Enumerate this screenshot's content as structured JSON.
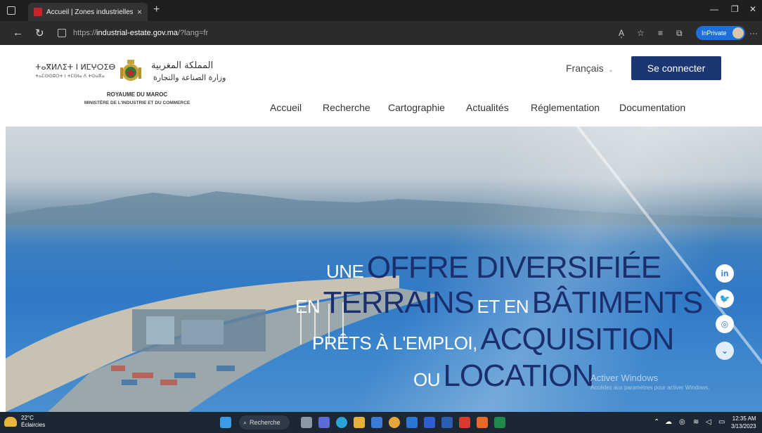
{
  "browser": {
    "tab_title": "Accueil | Zones industrielles Mar",
    "tab_close": "×",
    "new_tab": "+",
    "url_prefix": "https://",
    "url_host": "industrial-estate.gov.ma",
    "url_path": "/?lang=fr",
    "inprivate_label": "InPrivate",
    "read_aloud": "A͔",
    "minimize": "—",
    "restore": "❐",
    "close": "✕",
    "more": "···"
  },
  "header": {
    "tifinagh_1": "ⵜⴰⴳⵍⴷⵉⵜ ⵏ ⵍⵎⵖⵔⵉⴱ",
    "tifinagh_2": "ⵜⴰⵎⵙⵙⵓⵔⵜ ⵏ ⵜⵎⵙⵏⴰ ⴷ ⵜⵙⴰⴳⴰ",
    "arabic_1": "المملكة المغربية",
    "arabic_2": "وزارة الصناعة والتجارة",
    "royaume": "ROYAUME DU MAROC",
    "ministere": "MINISTÈRE DE L'INDUSTRIE ET DU COMMERCE",
    "language": "Français",
    "login_label": "Se connecter",
    "nav": [
      {
        "label": "Accueil"
      },
      {
        "label": "Recherche"
      },
      {
        "label": "Cartographie"
      },
      {
        "label": "Actualités"
      },
      {
        "label": "Réglementation"
      },
      {
        "label": "Documentation"
      }
    ]
  },
  "hero": {
    "line1_small": "UNE",
    "line1_big": "OFFRE DIVERSIFIÉE",
    "line2_small1": "EN",
    "line2_big1": "TERRAINS",
    "line2_small2": "ET EN",
    "line2_big2": "BÂTIMENTS",
    "line3_small": "PRÊTS À L'EMPLOI,",
    "line3_big": "ACQUISITION",
    "line4_small": "OU",
    "line4_big": "LOCATION",
    "social": {
      "linkedin": "in",
      "twitter": "🐦",
      "instagram": "◎",
      "scroll": "⌄"
    }
  },
  "watermark": {
    "line1": "Activer Windows",
    "line2": "Accédez aux paramètres pour activer Windows."
  },
  "taskbar": {
    "temperature": "22°C",
    "weather": "Éclaircies",
    "search_label": "Recherche",
    "time": "12:35 AM",
    "date": "3/13/2023"
  },
  "colors": {
    "navy": "#1a3773",
    "hero_blue": "#2f79c6",
    "chrome_dark": "#1f1f1f"
  }
}
